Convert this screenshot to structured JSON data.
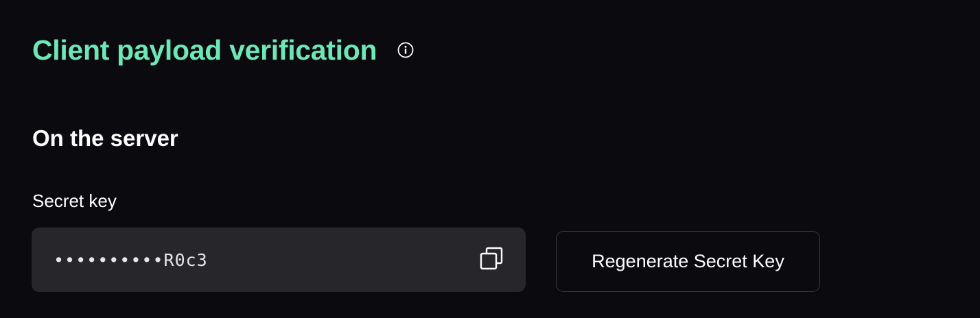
{
  "section": {
    "title": "Client payload verification",
    "info_icon": "info-icon",
    "subheading": "On the server"
  },
  "secret_key": {
    "label": "Secret key",
    "masked_value": "••••••••••R0c3",
    "copy_icon": "copy-icon"
  },
  "actions": {
    "regenerate_label": "Regenerate Secret Key"
  },
  "colors": {
    "background": "#0b0a0f",
    "title_accent": "#6ee7b7",
    "field_background": "#27262b",
    "button_border": "#3a3940",
    "text": "#ffffff"
  }
}
